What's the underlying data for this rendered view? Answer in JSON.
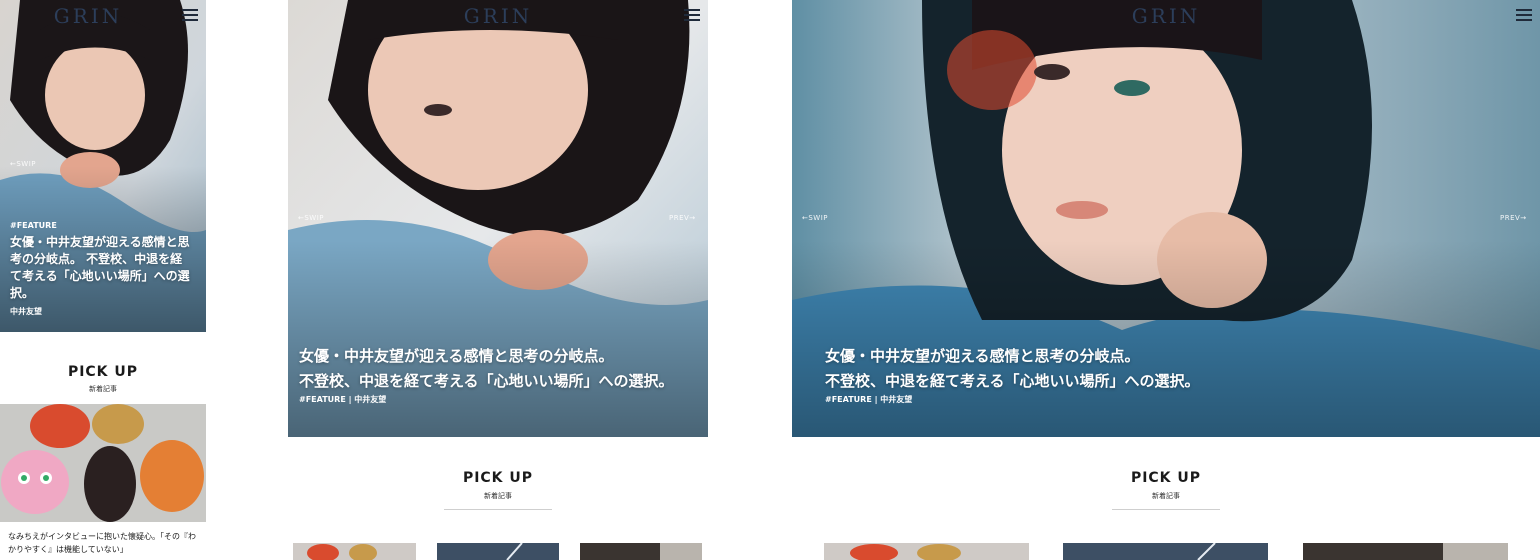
{
  "brand": {
    "logo": "GRIN"
  },
  "hero": {
    "swipe_label": "←SWIP",
    "prev_label": "PREV→",
    "category": "#FEATURE",
    "author": "中井友望",
    "tag_line": "#FEATURE | 中井友望",
    "title_mobile": "女優・中井友望が迎える感情と思考の分岐点。 不登校、中退を経て考える「心地いい場所」への選択。",
    "title_wide": "女優・中井友望が迎える感情と思考の分岐点。\n不登校、中退を経て考える「心地いい場所」への選択。"
  },
  "pickup": {
    "title": "PICK UP",
    "subtitle": "新着記事"
  },
  "articles": [
    {
      "excerpt": "なみちえがインタビューに抱いた懐疑心。「その『わかりやすく』は機能していない」"
    }
  ],
  "colors": {
    "logo": "#2c3e5a",
    "accent_blue": "#4f8fb7",
    "hair": "#17141a",
    "skin": "#e9c3b1"
  },
  "icons": [
    "menu-icon"
  ]
}
